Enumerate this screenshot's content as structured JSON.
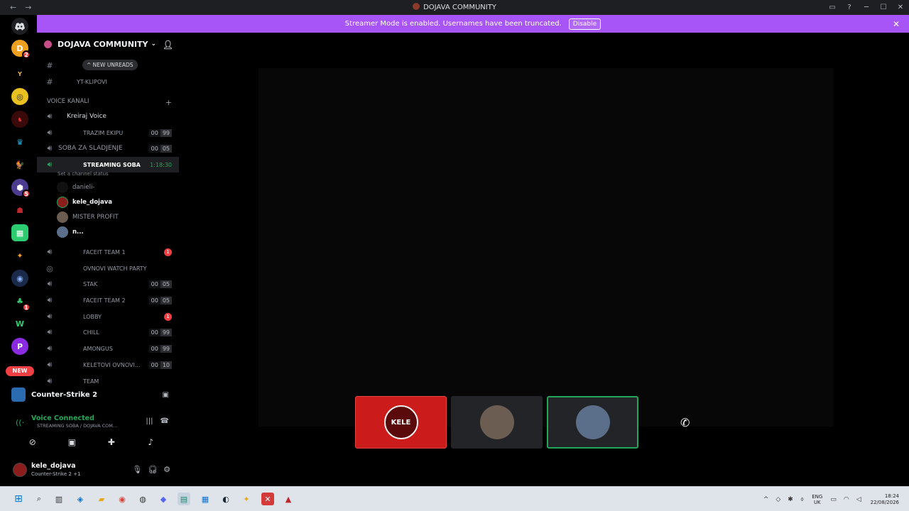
{
  "window": {
    "title": "DOJAVA COMMUNITY",
    "nav_back": "←",
    "nav_forward": "→",
    "inbox_icon": "▭",
    "help_icon": "?",
    "minimize": "─",
    "maximize": "☐",
    "close": "✕"
  },
  "banner": {
    "text": "Streamer Mode is enabled. Usernames have been truncated.",
    "button": "Disable",
    "close": "✕",
    "color": "#a855f7"
  },
  "rail": {
    "home_icon": "discord-icon",
    "new_label": "NEW",
    "badges": {
      "s1": "2",
      "s8": "5",
      "s13": "1"
    }
  },
  "guild": {
    "name": "DOJAVA COMMUNITY",
    "chevron": "⌄",
    "invite_icon": "+"
  },
  "channels": {
    "new_unreads": "^ NEW UNREADS",
    "text1_label": "YT-KLIPOVI",
    "category": "VOICE KANALI",
    "create_voice": "Kreiraj Voice",
    "items": [
      {
        "label": "TRAZIM EKIPU",
        "c1": "00",
        "c2": "99"
      },
      {
        "label": "SOBA ZA SLADJENJE",
        "c1": "00",
        "c2": "05"
      },
      {
        "label": "STREAMING SOBA",
        "timer": "1:18:30"
      },
      {
        "label": "FACEIT TEAM 1",
        "badge": "1"
      },
      {
        "label": "OVNOVI WATCH PARTY"
      },
      {
        "label": "STAK",
        "c1": "00",
        "c2": "05"
      },
      {
        "label": "FACEIT TEAM 2",
        "c1": "00",
        "c2": "05"
      },
      {
        "label": "LOBBY",
        "badge": "1"
      },
      {
        "label": "CHILL",
        "c1": "00",
        "c2": "99"
      },
      {
        "label": "AMONGUS",
        "c1": "00",
        "c2": "99"
      },
      {
        "label": "KELETOVI OVNOVI...",
        "c1": "00",
        "c2": "10"
      },
      {
        "label": "TEAM"
      }
    ],
    "channel_status": "Set a channel status",
    "voice_users": [
      "danieli-",
      "kele_dojava",
      "MISTER PROFIT",
      "n..."
    ]
  },
  "activity": {
    "game": "Counter-Strike 2",
    "voice_connected": "Voice Connected",
    "voice_sub": "STREAMING SOBA / DOJAVA COM..."
  },
  "me": {
    "name": "kele_dojava",
    "status": "Counter-Strike 2 +1"
  },
  "stage": {
    "tile1_text": "KELE"
  },
  "taskbar": {
    "lang_top": "ENG",
    "lang_bottom": "UK",
    "time": "18:24",
    "date": "22/08/2026"
  }
}
